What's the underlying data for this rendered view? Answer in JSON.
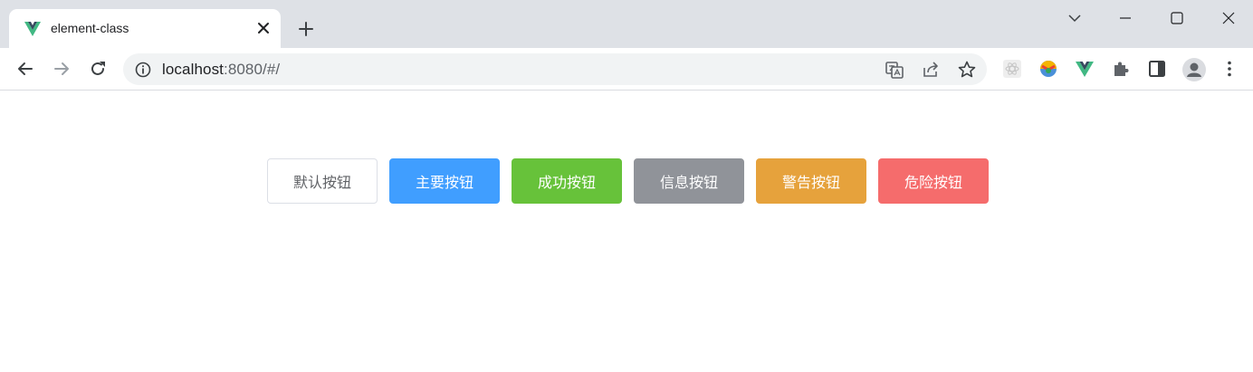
{
  "browser": {
    "tab": {
      "title": "element-class",
      "favicon": "vue-logo-icon"
    },
    "address_bar": {
      "host": "localhost",
      "rest": ":8080/#/"
    }
  },
  "buttons": [
    {
      "label": "默认按钮",
      "variant": "default",
      "color": "#ffffff"
    },
    {
      "label": "主要按钮",
      "variant": "primary",
      "color": "#409eff"
    },
    {
      "label": "成功按钮",
      "variant": "success",
      "color": "#67c23a"
    },
    {
      "label": "信息按钮",
      "variant": "info",
      "color": "#909399"
    },
    {
      "label": "警告按钮",
      "variant": "warning",
      "color": "#e6a23c"
    },
    {
      "label": "危险按钮",
      "variant": "danger",
      "color": "#f56c6c"
    }
  ]
}
